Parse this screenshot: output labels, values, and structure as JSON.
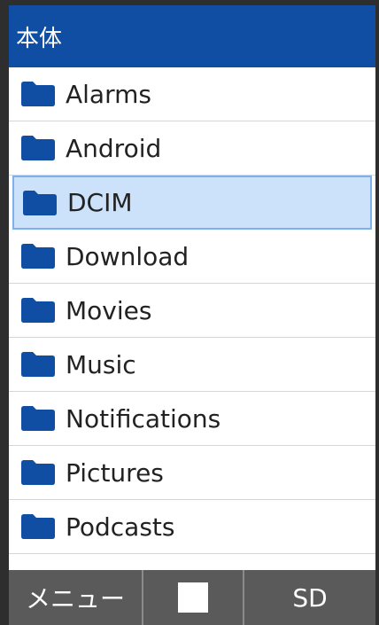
{
  "header": {
    "title": "本体"
  },
  "folders": [
    {
      "label": "Alarms",
      "selected": false
    },
    {
      "label": "Android",
      "selected": false
    },
    {
      "label": "DCIM",
      "selected": true
    },
    {
      "label": "Download",
      "selected": false
    },
    {
      "label": "Movies",
      "selected": false
    },
    {
      "label": "Music",
      "selected": false
    },
    {
      "label": "Notifications",
      "selected": false
    },
    {
      "label": "Pictures",
      "selected": false
    },
    {
      "label": "Podcasts",
      "selected": false
    }
  ],
  "softkeys": {
    "left": "メニュー",
    "center_icon": "square-icon",
    "right": "SD"
  },
  "colors": {
    "header_bg": "#0f4ea3",
    "folder_icon": "#0f4ea3",
    "selection_bg": "#cce2fb",
    "footer_bg": "#5a5a5a"
  }
}
